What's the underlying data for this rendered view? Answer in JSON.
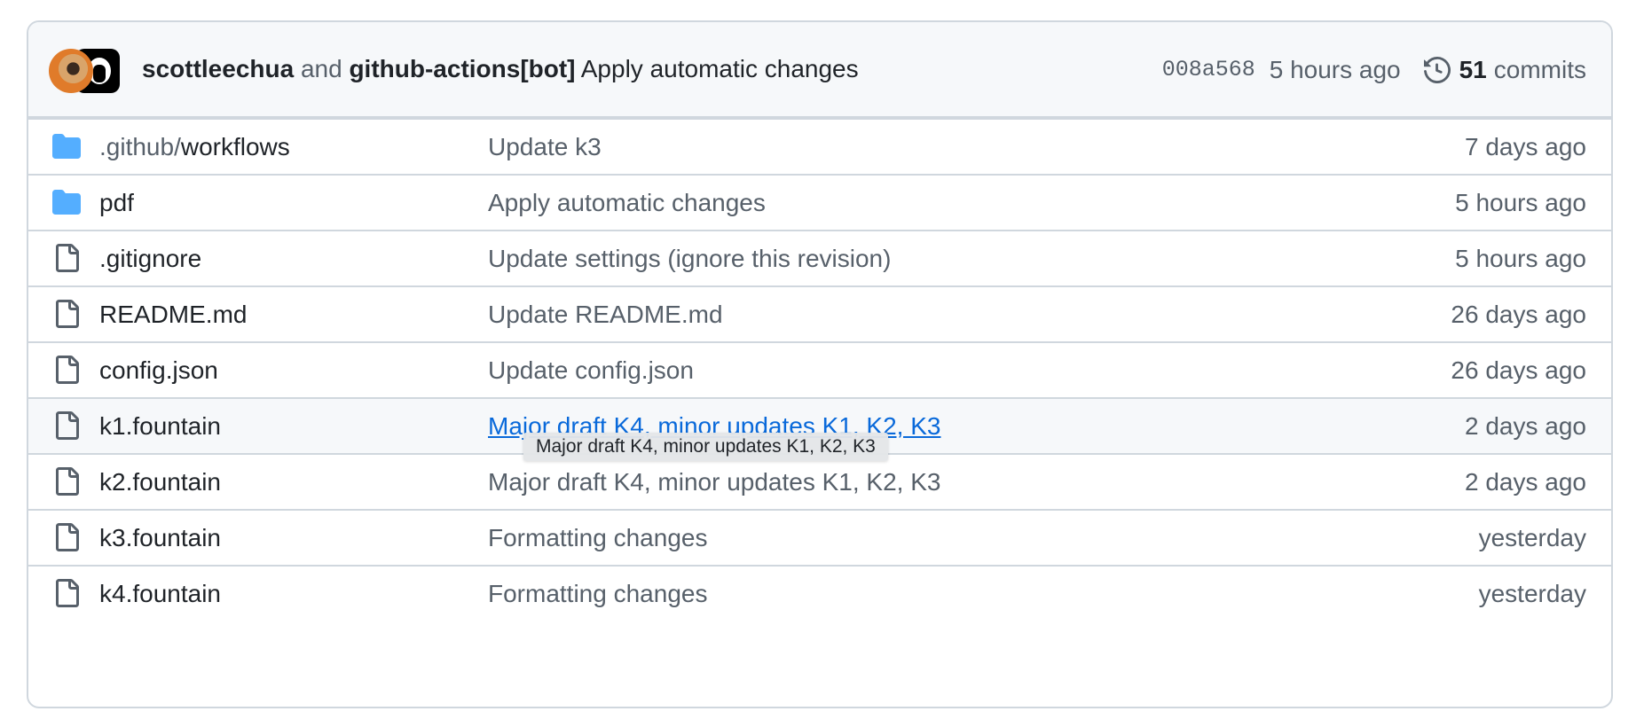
{
  "latest_commit": {
    "author_1": "scottleechua",
    "joiner": "and",
    "author_2": "github-actions[bot]",
    "message": "Apply automatic changes",
    "sha": "008a568",
    "time": "5 hours ago",
    "commits_count": "51",
    "commits_label": "commits",
    "icons": [
      "user-avatar",
      "bot-avatar",
      "history-icon"
    ]
  },
  "files": [
    {
      "type": "folder",
      "name_prefix": ".github/",
      "name": "workflows",
      "commit": "Update k3",
      "age": "7 days ago"
    },
    {
      "type": "folder",
      "name_prefix": "",
      "name": "pdf",
      "commit": "Apply automatic changes",
      "age": "5 hours ago"
    },
    {
      "type": "file",
      "name_prefix": "",
      "name": ".gitignore",
      "commit": "Update settings (ignore this revision)",
      "age": "5 hours ago"
    },
    {
      "type": "file",
      "name_prefix": "",
      "name": "README.md",
      "commit": "Update README.md",
      "age": "26 days ago"
    },
    {
      "type": "file",
      "name_prefix": "",
      "name": "config.json",
      "commit": "Update config.json",
      "age": "26 days ago"
    },
    {
      "type": "file",
      "name_prefix": "",
      "name": "k1.fountain",
      "commit": "Major draft K4, minor updates K1, K2, K3",
      "age": "2 days ago",
      "hovered": true
    },
    {
      "type": "file",
      "name_prefix": "",
      "name": "k2.fountain",
      "commit": "Major draft K4, minor updates K1, K2, K3",
      "age": "2 days ago"
    },
    {
      "type": "file",
      "name_prefix": "",
      "name": "k3.fountain",
      "commit": "Formatting changes",
      "age": "yesterday"
    },
    {
      "type": "file",
      "name_prefix": "",
      "name": "k4.fountain",
      "commit": "Formatting changes",
      "age": "yesterday"
    }
  ],
  "tooltip": {
    "text": "Major draft K4, minor updates K1, K2, K3"
  },
  "colors": {
    "folder": "#54aeff",
    "link": "#0969da",
    "muted": "#57606a",
    "border": "#d0d7de",
    "header_bg": "#f6f8fa"
  }
}
